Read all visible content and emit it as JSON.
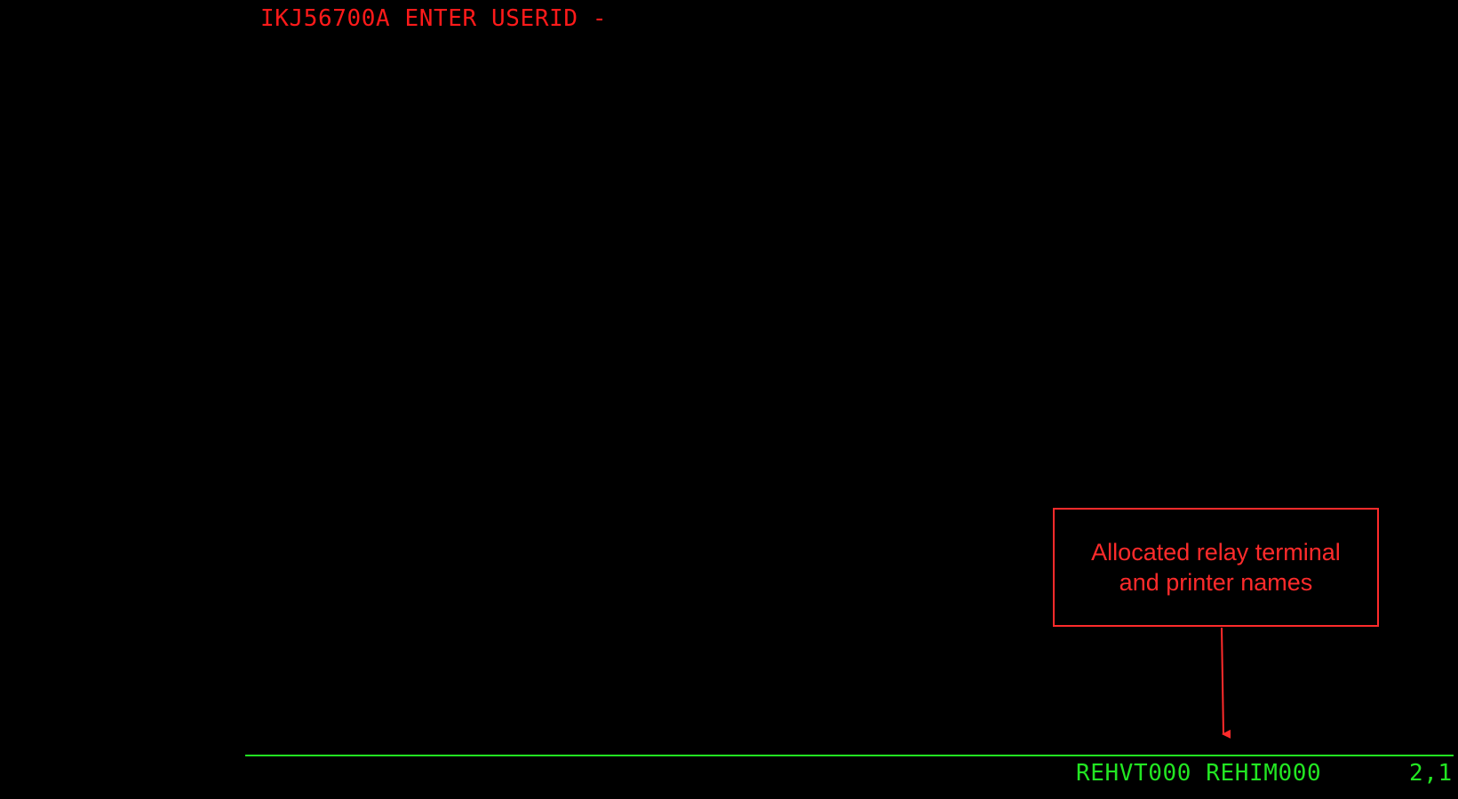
{
  "terminal": {
    "prompt": "IKJ56700A ENTER USERID -",
    "status": {
      "names": "REHVT000 REHIM000",
      "cursor_position": "2,1"
    }
  },
  "annotation": {
    "text": "Allocated relay terminal\nand printer names"
  },
  "colors": {
    "background": "#000000",
    "prompt_text": "#ff1a1a",
    "annotation": "#ff2b2b",
    "status_text": "#22e622",
    "status_rule": "#22e622"
  }
}
